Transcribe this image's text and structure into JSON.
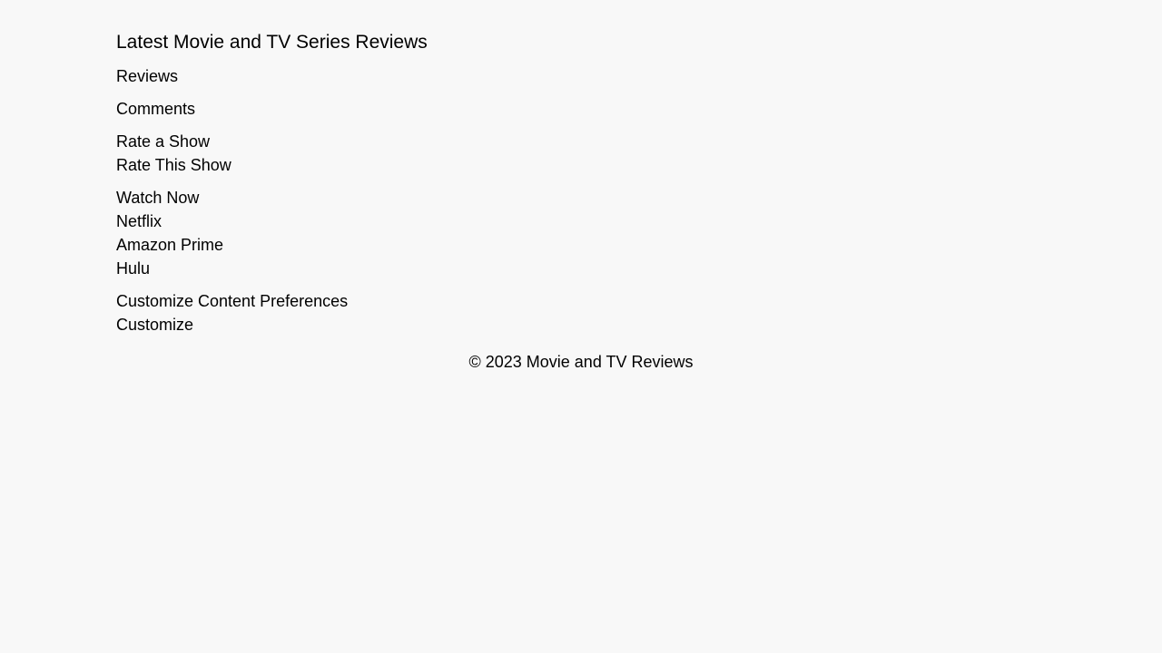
{
  "header": {
    "title": "Latest Movie and TV Series Reviews"
  },
  "nav": {
    "reviews": "Reviews",
    "comments": "Comments"
  },
  "rate": {
    "title": "Rate a Show",
    "action": "Rate This Show"
  },
  "watch": {
    "title": "Watch Now",
    "services": [
      "Netflix",
      "Amazon Prime",
      "Hulu"
    ]
  },
  "customize": {
    "title": "Customize Content Preferences",
    "action": "Customize"
  },
  "footer": {
    "copyright": "© 2023 Movie and TV Reviews"
  }
}
